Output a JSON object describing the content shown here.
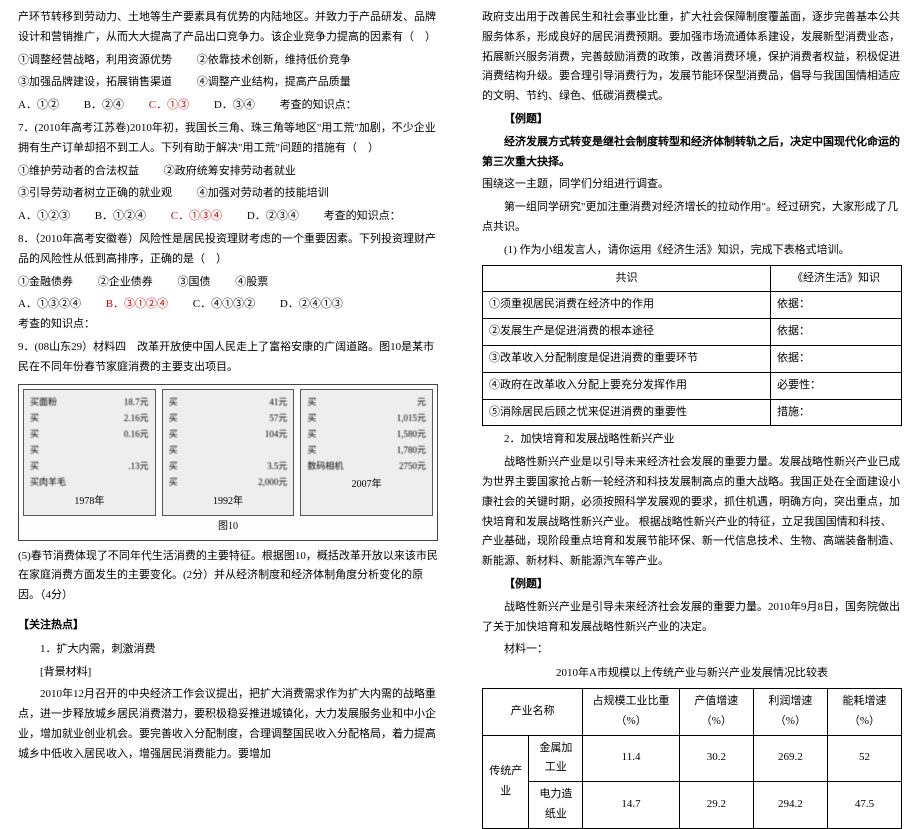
{
  "left": {
    "para_intro": "产环节转移到劳动力、土地等生产要素具有优势的内陆地区。并致力于产品研发、品牌设计和营销推广，从而大大提高了产品出口竞争力。该企业竞争力提高的因素有（　）",
    "opts1": [
      "①调整经营战略，利用资源优势",
      "②依靠技术创新，维持低价竞争",
      "③加强品牌建设，拓展销售渠道",
      "④调整产业结构，提高产品质量"
    ],
    "choice1": {
      "A": "A．①②",
      "B": "B．②④",
      "C": "C．①③",
      "D": "D．③④",
      "kp": "考查的知识点："
    },
    "q7": "7．(2010年高考江苏卷)2010年初，我国长三角、珠三角等地区\"用工荒\"加剧，不少企业拥有生产订单却招不到工人。下列有助于解决\"用工荒\"问题的措施有（　）",
    "opts2": [
      "①维护劳动者的合法权益",
      "②政府统筹安排劳动者就业",
      "③引导劳动者树立正确的就业观",
      "④加强对劳动者的技能培训"
    ],
    "choice2": {
      "A": "A．①②③",
      "B": "B．①②④",
      "C": "C．①③④",
      "D": "D．②③④",
      "kp": "考查的知识点："
    },
    "q8": "8．（2010年高考安徽卷）风险性是居民投资理财考虑的一个重要因素。下列投资理财产品的风险性从低到高排序，正确的是（　）",
    "opts3": [
      "①金融债券",
      "②企业债券",
      "③国债",
      "④股票"
    ],
    "choice3": {
      "A": "A．①③②④",
      "B": "B．③①②④",
      "C": "C．④①③②",
      "D": "D．②④①③",
      "kp": "考查的知识点："
    },
    "q9": "9．(08山东29）材料四　改革开放使中国人民走上了富裕安康的广阔道路。图10是某市民在不同年份春节家庭消费的主要支出项目。",
    "fig": {
      "cards": [
        {
          "year": "1978年",
          "rows": [
            {
              "l": "买面粉",
              "v": "18.7元"
            },
            {
              "l": "买",
              "v": "2.16元"
            },
            {
              "l": "买",
              "v": "0.16元"
            },
            {
              "l": "买",
              "v": ""
            },
            {
              "l": "买",
              "v": ".13元"
            },
            {
              "l": "买肉羊毛",
              "v": ""
            }
          ]
        },
        {
          "year": "1992年",
          "rows": [
            {
              "l": "买",
              "v": "41元"
            },
            {
              "l": "买",
              "v": "57元"
            },
            {
              "l": "买",
              "v": "104元"
            },
            {
              "l": "买",
              "v": ""
            },
            {
              "l": "买",
              "v": "3.5元"
            },
            {
              "l": "买",
              "v": "2,000元"
            }
          ]
        },
        {
          "year": "2007年",
          "rows": [
            {
              "l": "买",
              "v": "元"
            },
            {
              "l": "买",
              "v": "1,015元"
            },
            {
              "l": "买",
              "v": "1,580元"
            },
            {
              "l": "买",
              "v": "1,780元"
            },
            {
              "l": "数码相机",
              "v": "2750元"
            }
          ]
        }
      ],
      "caption": "图10"
    },
    "q9sub": "(5)春节消费体现了不同年代生活消费的主要特征。根据图10，概括改革开放以来该市民在家庭消费方面发生的主要变化。(2分）并从经济制度和经济体制角度分析变化的原因。（4分）",
    "hot_head": "【关注热点】",
    "hot1_title": "1．扩大内需，刺激消费",
    "hot1_bg": "[背景材料]",
    "hot1_para": "2010年12月召开的中央经济工作会议提出，把扩大消费需求作为扩大内需的战略重点，进一步释放城乡居民消费潜力，要积极稳妥推进城镇化，大力发展服务业和中小企业，增加就业创业机会。要完善收入分配制度，合理调整国民收入分配格局，着力提高城乡中低收入居民收入，增强居民消费能力。要增加"
  },
  "right": {
    "para1": "政府支出用于改善民生和社会事业比重，扩大社会保障制度覆盖面，逐步完善基本公共服务体系，形成良好的居民消费预期。要加强市场流通体系建设，发展新型消费业态，拓展新兴服务消费，完善鼓励消费的政策，改善消费环境，保护消费者权益，积极促进消费结构升级。要合理引导消费行为，发展节能环保型消费品，倡导与我国国情相适应的文明、节约、绿色、低碳消费模式。",
    "ex_head": "【例题】",
    "ex_para": "经济发展方式转变是继社会制度转型和经济体制转轨之后，决定中国现代化命运的第三次重大抉择。",
    "ex_sub": "围绕这一主题，同学们分组进行调查。",
    "group1": "第一组同学研究\"更加注重消费对经济增长的拉动作用\"。经过研究，大家形成了几点共识。",
    "task1": "(1) 作为小组发言人，请你运用《经济生活》知识，完成下表格式培训。",
    "table1": {
      "head": [
        "共识",
        "《经济生活》知识"
      ],
      "rows": [
        [
          "①须重视居民消费在经济中的作用",
          "依据："
        ],
        [
          "②发展生产是促进消费的根本途径",
          "依据："
        ],
        [
          "③改革收入分配制度是促进消费的重要环节",
          "依据："
        ],
        [
          "④政府在改革收入分配上要充分发挥作用",
          "必要性："
        ],
        [
          "⑤消除居民后顾之忧来促进消费的重要性",
          "措施："
        ]
      ]
    },
    "sec2_title": "2．加快培育和发展战略性新兴产业",
    "sec2_para": "战略性新兴产业是以引导未来经济社会发展的重要力量。发展战略性新兴产业已成为世界主要国家抢占新一轮经济和科技发展制高点的重大战略。我国正处在全面建设小康社会的关键时期，必须按照科学发展观的要求，抓住机遇，明确方向，突出重点，加快培育和发展战略性新兴产业。 根据战略性新兴产业的特征，立足我国国情和科技、产业基础，现阶段重点培育和发展节能环保、新一代信息技术、生物、高端装备制造、新能源、新材料、新能源汽车等产业。",
    "ex2_head": "【例题】",
    "ex2_para": "战略性新兴产业是引导未来经济社会发展的重要力量。2010年9月8日，国务院做出了关于加快培育和发展战略性新兴产业的决定。",
    "mat_head": "材料一：",
    "table2_title": "2010年A市规模以上传统产业与新兴产业发展情况比较表",
    "chart_data": {
      "type": "table",
      "title": "2010年A市规模以上传统产业与新兴产业发展情况比较表",
      "columns": [
        "产业名称",
        "占规模工业比重（%）",
        "产值增速（%）",
        "利润增速（%）",
        "能耗增速（%）"
      ],
      "rows": [
        {
          "group": "传统产业",
          "name": "金属加工业",
          "share": 11.4,
          "output": 30.2,
          "profit": 269.2,
          "energy": 52.0
        },
        {
          "group": "传统产业",
          "name": "电力造纸业",
          "share": 14.7,
          "output": 29.2,
          "profit": 294.2,
          "energy": 47.5
        }
      ]
    }
  }
}
